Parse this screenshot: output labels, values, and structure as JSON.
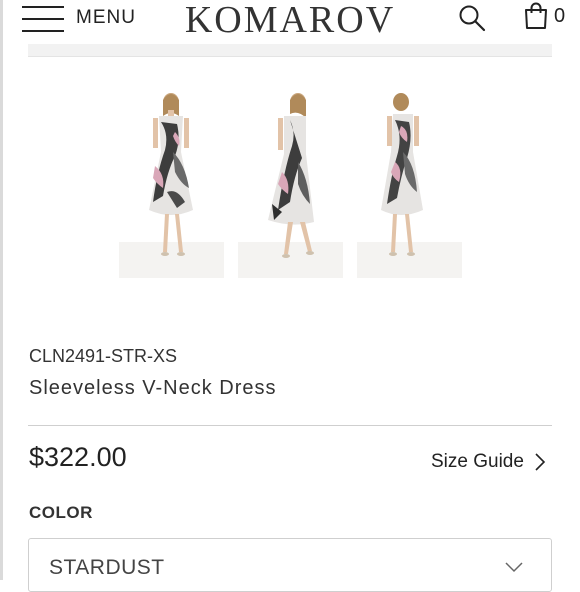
{
  "header": {
    "menu_label": "MENU",
    "logo_text": "KOMAROV",
    "cart_count": "0"
  },
  "icons": {
    "menu": "hamburger-icon",
    "search": "search-icon",
    "cart": "shopping-bag-icon",
    "size_guide": "chevron-right-icon",
    "select": "chevron-down-icon"
  },
  "gallery": {
    "thumbnails": [
      "dress-front-view",
      "dress-three-quarter-view",
      "dress-back-view"
    ]
  },
  "product": {
    "sku": "CLN2491-STR-XS",
    "title": "Sleeveless V-Neck Dress",
    "price": "$322.00",
    "size_guide_label": "Size Guide",
    "color_label": "COLOR",
    "color_selected": "STARDUST"
  },
  "colors": {
    "text": "#222222",
    "divider": "#cfcfcf",
    "dress_print": [
      "#3a3a3a",
      "#d9a7b8",
      "#e8e8e8"
    ]
  }
}
